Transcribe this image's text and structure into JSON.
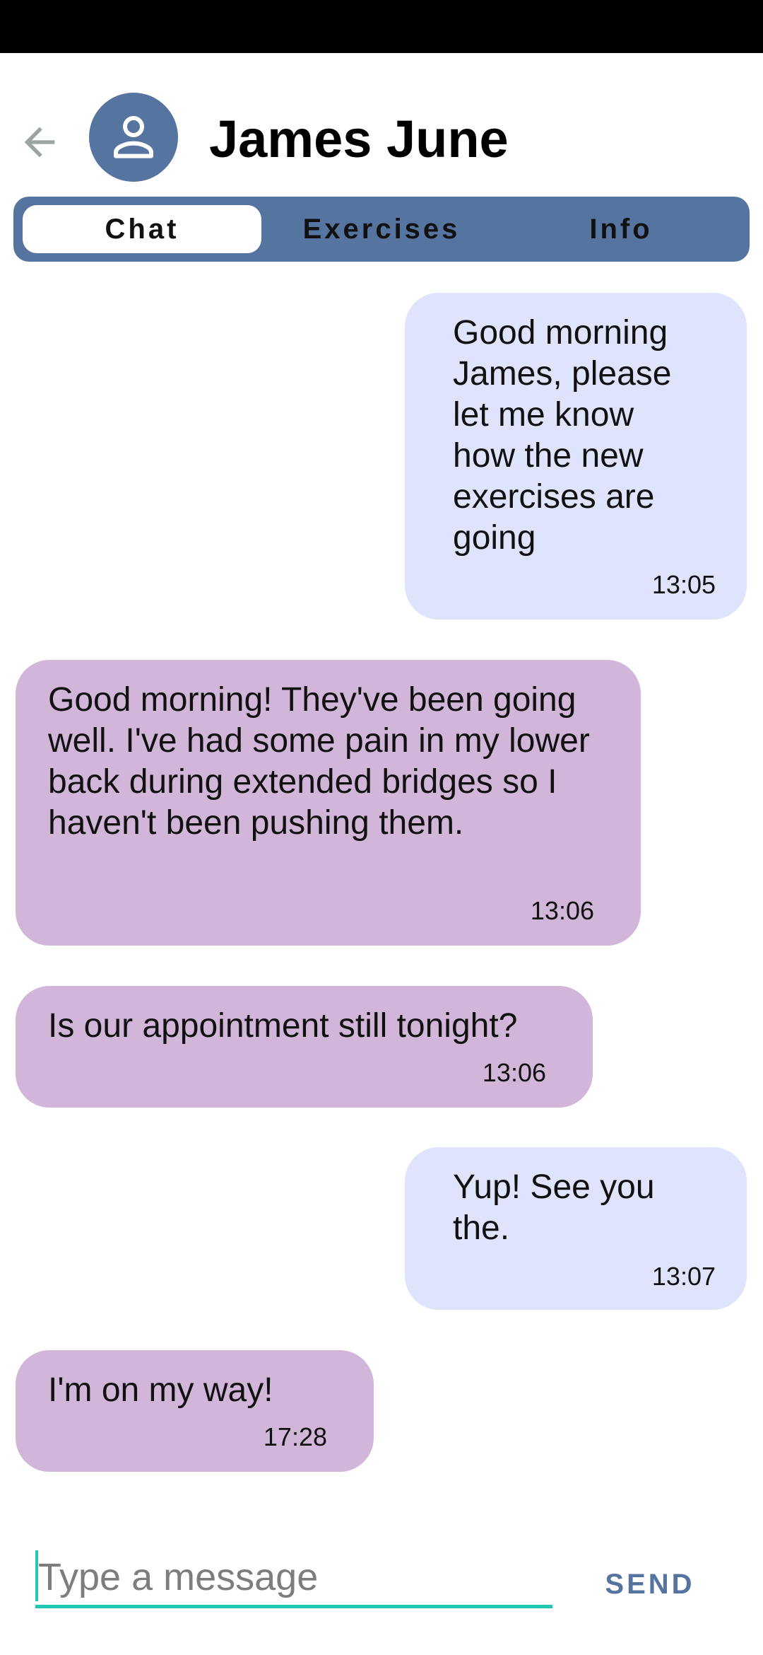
{
  "header": {
    "back_icon": "arrow-left-icon",
    "avatar_icon": "person-icon",
    "contact_name": "James June"
  },
  "tabs": [
    {
      "label": "Chat",
      "active": true
    },
    {
      "label": "Exercises",
      "active": false
    },
    {
      "label": "Info",
      "active": false
    }
  ],
  "messages": [
    {
      "direction": "sent",
      "text": "Good morning James, please let me know how the new exercises are going",
      "time": "13:05"
    },
    {
      "direction": "received",
      "text": "Good morning! They've been going well. I've had some pain in my lower back during extended bridges so I haven't been pushing them.",
      "time": "13:06"
    },
    {
      "direction": "received",
      "text": "Is our appointment still tonight?",
      "time": "13:06"
    },
    {
      "direction": "sent",
      "text": "Yup! See you the.",
      "time": "13:07"
    },
    {
      "direction": "received",
      "text": "I'm on my way!",
      "time": "17:28"
    }
  ],
  "composer": {
    "placeholder": "Type a message",
    "value": "",
    "send_label": "SEND"
  },
  "colors": {
    "accent": "#5574a0",
    "sent_bubble": "#dfe4fc",
    "received_bubble": "#d1b6da",
    "input_underline": "#1fc8b4"
  }
}
